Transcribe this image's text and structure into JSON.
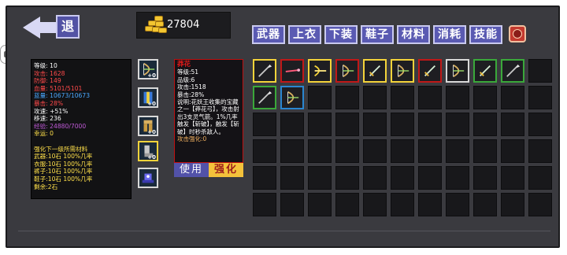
{
  "header": {
    "back_label": "退",
    "gold": "27804",
    "tabs": [
      "武器",
      "上衣",
      "下装",
      "鞋子",
      "材料",
      "消耗",
      "技能"
    ]
  },
  "stats": {
    "lines": [
      {
        "text": "等级: 10",
        "color": "#ffffff"
      },
      {
        "text": "攻击: 1628",
        "color": "#ff4a4a"
      },
      {
        "text": "防御: 149",
        "color": "#ff4a4a"
      },
      {
        "text": "血量: 5101/5101",
        "color": "#ff4a4a"
      },
      {
        "text": "蓝量: 10673/10673",
        "color": "#4aa8ff"
      },
      {
        "text": "暴击: 28%",
        "color": "#ff4a4a"
      },
      {
        "text": "攻速: +51%",
        "color": "#ffffff"
      },
      {
        "text": "移速: 236",
        "color": "#ffffff"
      },
      {
        "text": "经验: 24880/7000",
        "color": "#c05ad8"
      },
      {
        "text": "幸运: 0",
        "color": "#ffe04a"
      },
      {
        "text": "",
        "color": "#ffffff"
      },
      {
        "text": "强化下一级所需材料",
        "color": "#ffe04a"
      },
      {
        "text": "武器:10石 100%几率",
        "color": "#ffe04a"
      },
      {
        "text": "衣服:10石 100%几率",
        "color": "#ffe04a"
      },
      {
        "text": "裤子:10石 100%几率",
        "color": "#ffe04a"
      },
      {
        "text": "鞋子:10石 100%几率",
        "color": "#ffe04a"
      },
      {
        "text": "剩余:2石",
        "color": "#ffe04a"
      }
    ]
  },
  "equipment": [
    {
      "icon": "bow-icon",
      "plus": "+0",
      "border": "#d8d8d8"
    },
    {
      "icon": "robe-icon",
      "plus": "+0",
      "border": "#d8d8d8"
    },
    {
      "icon": "pants-icon",
      "plus": "+0",
      "border": "#d8d8d8"
    },
    {
      "icon": "boots-icon",
      "plus": "+0",
      "border": "#f4d33a"
    },
    {
      "icon": "mech-icon",
      "plus": "",
      "border": "#d8d8d8"
    }
  ],
  "tooltip": {
    "name": "莽花",
    "level": "等级:51",
    "grade": "品级:6",
    "attack": "攻击:1518",
    "crit": "暴击:28%",
    "desc": "说明:花妖王收集的宝藏之一【莽花弓】，攻击射出3支灵气箭。1%几率触发【斩破】，触发【斩破】时秒杀敌人。",
    "req": "攻击强化:0",
    "use_label": "使用",
    "upgrade_label": "强化"
  },
  "inventory": {
    "rows": 6,
    "cols": 11,
    "items": [
      {
        "index": 0,
        "icon": "spear-icon",
        "border": "#f4d33a"
      },
      {
        "index": 1,
        "icon": "wand-icon",
        "border": "#c01818"
      },
      {
        "index": 2,
        "icon": "crossbow-icon",
        "border": "#f4d33a"
      },
      {
        "index": 3,
        "icon": "bow-icon",
        "border": "#c01818"
      },
      {
        "index": 4,
        "icon": "sword-icon",
        "border": "#f4d33a"
      },
      {
        "index": 5,
        "icon": "bow-icon",
        "border": "#f4d33a"
      },
      {
        "index": 6,
        "icon": "sword-icon",
        "border": "#c01818"
      },
      {
        "index": 7,
        "icon": "bow-icon",
        "border": "#d8d8d8"
      },
      {
        "index": 8,
        "icon": "sword-icon",
        "border": "#3aa83a"
      },
      {
        "index": 9,
        "icon": "spear-icon",
        "border": "#3aa83a"
      },
      {
        "index": 11,
        "icon": "spear-icon",
        "border": "#3aa83a"
      },
      {
        "index": 12,
        "icon": "bow-icon",
        "border": "#2a86d0"
      }
    ]
  }
}
